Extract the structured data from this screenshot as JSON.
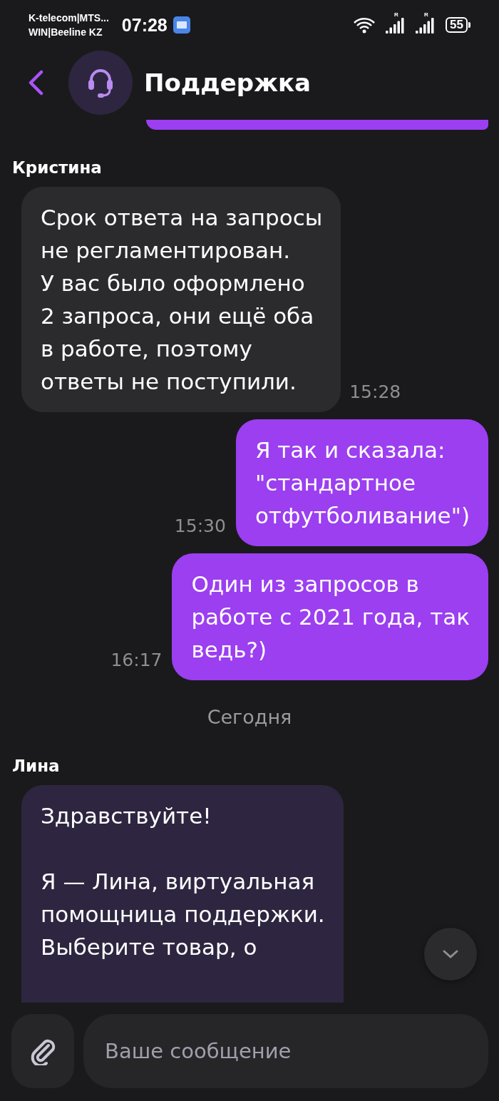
{
  "status_bar": {
    "carrier_lines": [
      "K-telecom|MTS...",
      "WIN|Beeline KZ"
    ],
    "time": "07:28",
    "signal_marks": [
      "R",
      "R"
    ],
    "battery": "55"
  },
  "header": {
    "title": "Поддержка"
  },
  "messages": [
    {
      "kind": "clipped"
    },
    {
      "kind": "incoming",
      "sender": "Кристина",
      "bot": false,
      "text": "Срок ответа на запросы\nне регламентирован.\nУ вас было оформлено\n2 запроса, они ещё оба\nв работе, поэтому\nответы не поступили.",
      "time": "15:28"
    },
    {
      "kind": "outgoing",
      "text": "Я так и сказала:\n\"стандартное\nотфутболивание\")",
      "time": "15:30"
    },
    {
      "kind": "outgoing",
      "text": "Один из запросов в\nработе с 2021 года, так\nведь?)",
      "time": "16:17"
    },
    {
      "kind": "date",
      "text": "Сегодня"
    },
    {
      "kind": "incoming",
      "sender": "Лина",
      "bot": true,
      "text": "Здравствуйте!\n\nЯ — Лина, виртуальная\nпомощница поддержки.\nВыберите товар, о"
    }
  ],
  "composer": {
    "placeholder": "Ваше сообщение"
  }
}
